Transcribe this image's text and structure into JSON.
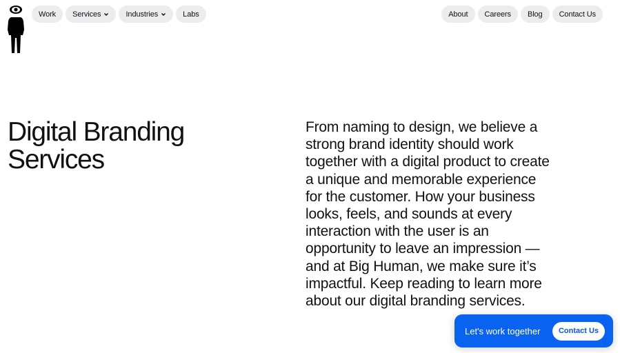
{
  "brand": {
    "logo_icon": "human-eye-figure-icon"
  },
  "nav": {
    "left": [
      {
        "label": "Work",
        "dropdown": false
      },
      {
        "label": "Services",
        "dropdown": true
      },
      {
        "label": "Industries",
        "dropdown": true
      },
      {
        "label": "Labs",
        "dropdown": false
      }
    ],
    "right": [
      {
        "label": "About"
      },
      {
        "label": "Careers"
      },
      {
        "label": "Blog"
      },
      {
        "label": "Contact Us"
      }
    ]
  },
  "hero": {
    "title_lines": [
      "Digital Branding",
      "Services"
    ],
    "body_lines": [
      "From naming to design, we believe a",
      "strong brand identity should work",
      "together with a digital product to create",
      "a unique and memorable experience",
      "for the customer. How your business",
      "looks, feels, and sounds at every",
      "interaction with the user is an",
      "opportunity to leave an impression —",
      "and at Big Human, we make sure it’s",
      "impactful. Keep reading to learn more",
      "about our digital branding services."
    ]
  },
  "cta": {
    "text": "Let's work together",
    "button_label": "Contact Us",
    "color": "#0a62f0"
  }
}
